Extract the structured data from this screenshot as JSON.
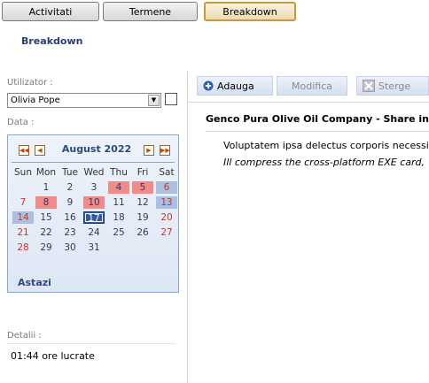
{
  "tabs": [
    {
      "label": "Activitati"
    },
    {
      "label": "Termene"
    },
    {
      "label": "Breakdown"
    }
  ],
  "active_tab": "Breakdown",
  "section_title": "Breakdown",
  "user": {
    "label": "Utilizator :",
    "value": "Olivia Pope"
  },
  "date_label": "Data :",
  "calendar": {
    "month_title": "August 2022",
    "weekdays": [
      "Sun",
      "Mon",
      "Tue",
      "Wed",
      "Thu",
      "Fri",
      "Sat"
    ],
    "days": [
      [
        "",
        "1",
        "2",
        "3",
        "4",
        "5",
        "6"
      ],
      [
        "7",
        "8",
        "9",
        "10",
        "11",
        "12",
        "13"
      ],
      [
        "14",
        "15",
        "16",
        "17",
        "18",
        "19",
        "20"
      ],
      [
        "21",
        "22",
        "23",
        "24",
        "25",
        "26",
        "27"
      ],
      [
        "28",
        "29",
        "30",
        "31",
        "",
        "",
        ""
      ]
    ],
    "highlight_red": [
      "4",
      "5",
      "8",
      "10"
    ],
    "highlight_blue": [
      "6",
      "13",
      "14"
    ],
    "selected": "17",
    "today_link": "Astazi"
  },
  "details": {
    "label": "Detalii :",
    "value": "01:44 ore lucrate"
  },
  "toolbar": {
    "add": "Adauga",
    "edit": "Modifica",
    "delete": "Sterge"
  },
  "content": {
    "title": "Genco Pura Olive Oil Company - Share incent",
    "item_title": "Voluptatem ipsa delectus corporis necessi",
    "item_sub": "Ill compress the cross-platform EXE card,"
  },
  "colors": {
    "accent": "#2a4a80",
    "weekend": "#c0392b",
    "highlight_red": "#f28a8a",
    "highlight_blue": "#a9bfe3",
    "selected": "#2d5ba8"
  }
}
